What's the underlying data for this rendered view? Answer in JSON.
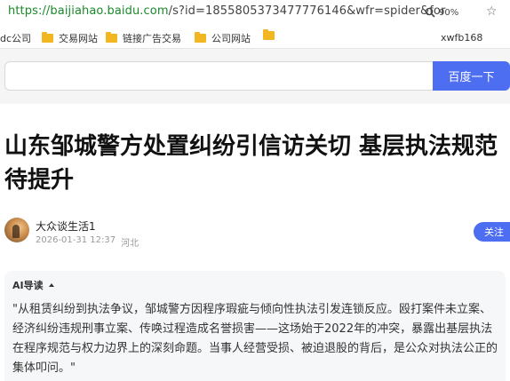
{
  "browser": {
    "url_proto": "https://",
    "url_host": "baijiahao.baidu.com",
    "url_path": "/s?id=1855805373477776146&wfr=spider&for",
    "zoom_level": "90%"
  },
  "bookmarks": {
    "items": [
      {
        "label": "dc公司",
        "has_folder": false
      },
      {
        "label": "交易网站",
        "has_folder": true
      },
      {
        "label": "链接广告交易",
        "has_folder": true
      },
      {
        "label": "公司网站",
        "has_folder": true
      },
      {
        "label": "",
        "has_folder": true
      }
    ],
    "right_label": "xwfb168"
  },
  "search": {
    "value": "",
    "button_label": "百度一下"
  },
  "article": {
    "title": "山东邹城警方处置纠纷引信访关切 基层执法规范待提升",
    "author_name": "大众谈生活1",
    "date": "2026-01-31 12:37",
    "location": "河北",
    "follow_label": "关注"
  },
  "ai_summary": {
    "header": "AI导读",
    "text": "\"从租赁纠纷到执法争议，邹城警方因程序瑕疵与倾向性执法引发连锁反应。殴打案件未立案、经济纠纷违规刑事立案、传唤过程造成名誉损害——这场始于2022年的冲突，暴露出基层执法在程序规范与权力边界上的深刻命题。当事人经营受损、被迫退股的背后，是公众对执法公正的集体叩问。\""
  },
  "colors": {
    "url_green": "#1a8a2a",
    "baidu_blue": "#4e6ef2",
    "folder_yellow": "#f2b720"
  },
  "icons": {
    "zoom": "magnifier-icon",
    "star": "star-icon",
    "folder": "folder-icon",
    "ai_caret": "caret-up-icon"
  }
}
